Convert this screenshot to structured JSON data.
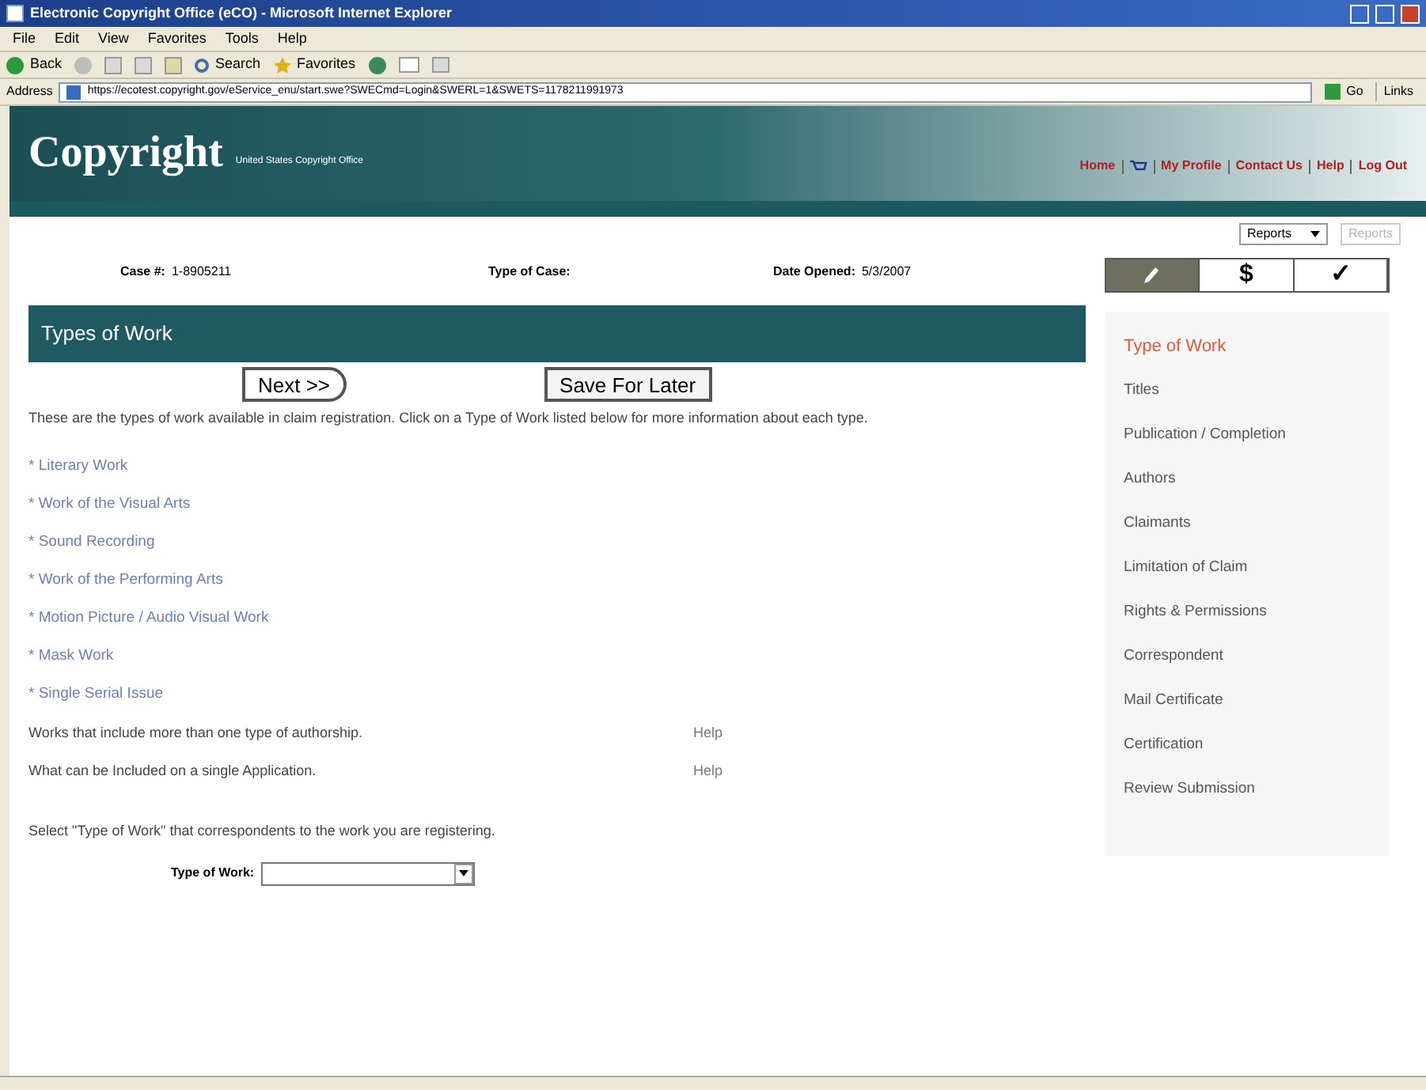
{
  "window": {
    "title": "Electronic Copyright Office (eCO) - Microsoft Internet Explorer"
  },
  "menu": [
    "File",
    "Edit",
    "View",
    "Favorites",
    "Tools",
    "Help"
  ],
  "toolbar": {
    "back": "Back",
    "search": "Search",
    "favorites": "Favorites"
  },
  "address": {
    "label": "Address",
    "url": "https://ecotest.copyright.gov/eService_enu/start.swe?SWECmd=Login&SWERL=1&SWETS=1178211991973",
    "go": "Go",
    "links": "Links"
  },
  "header": {
    "logo": "Copyright",
    "subtitle": "United States Copyright Office",
    "nav": [
      {
        "kind": "link",
        "label": "Home"
      },
      {
        "kind": "cart"
      },
      {
        "kind": "link",
        "label": "My Profile"
      },
      {
        "kind": "link",
        "label": "Contact Us"
      },
      {
        "kind": "link",
        "label": "Help"
      },
      {
        "kind": "link",
        "label": "Log Out"
      }
    ]
  },
  "reports": {
    "select": "Reports",
    "button": "Reports",
    "button_disabled": true
  },
  "case": {
    "case_label": "Case #:",
    "case_value": "1-8905211",
    "type_label": "Type of Case:",
    "date_label": "Date Opened:",
    "date_value": "5/3/2007"
  },
  "step_tabs": [
    {
      "kind": "pencil",
      "selected": true
    },
    {
      "kind": "text",
      "label": "$",
      "selected": false
    },
    {
      "kind": "text",
      "label": "✓",
      "selected": false
    }
  ],
  "section": {
    "title": "Types of Work",
    "next": "Next >>",
    "save": "Save For Later",
    "intro": "These are the types of work available in claim registration. Click on a Type of Work listed below for more information about each type.",
    "work_types": [
      "* Literary Work",
      "* Work of the Visual Arts",
      "* Sound Recording",
      "* Work of the Performing Arts",
      "* Motion Picture / Audio Visual Work",
      "* Mask Work",
      "* Single Serial Issue"
    ],
    "info_rows": [
      {
        "text": "Works that include more than one type of authorship.",
        "link": "Help"
      },
      {
        "text": "What can be Included on a single Application.",
        "link": "Help"
      }
    ],
    "prompt": "Select \"Type of Work\" that correspondents to the work you are registering.",
    "field_label": "Type of Work:"
  },
  "steps": [
    {
      "label": "Type of Work",
      "selected": true
    },
    {
      "label": "Titles",
      "selected": false
    },
    {
      "label": "Publication / Completion",
      "selected": false
    },
    {
      "label": "Authors",
      "selected": false
    },
    {
      "label": "Claimants",
      "selected": false
    },
    {
      "label": "Limitation of Claim",
      "selected": false
    },
    {
      "label": "Rights & Permissions",
      "selected": false
    },
    {
      "label": "Correspondent",
      "selected": false
    },
    {
      "label": "Mail Certificate",
      "selected": false
    },
    {
      "label": "Certification",
      "selected": false
    },
    {
      "label": "Review Submission",
      "selected": false
    }
  ]
}
